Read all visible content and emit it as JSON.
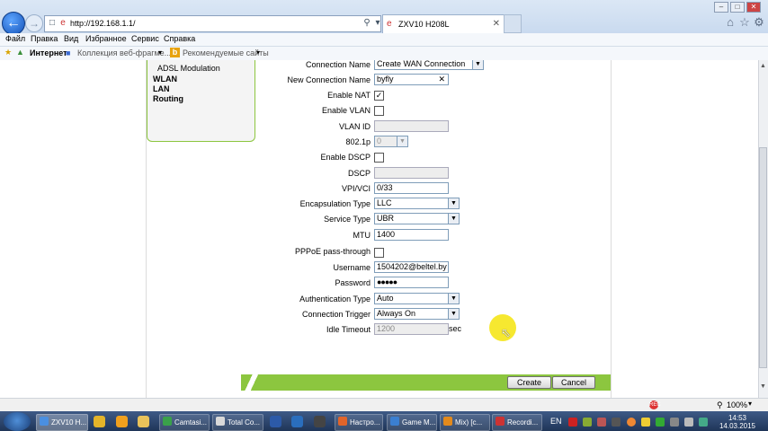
{
  "browser": {
    "url": "http://192.168.1.1/",
    "tab_title": "ZXV10 H208L",
    "menu": [
      "Файл",
      "Правка",
      "Вид",
      "Избранное",
      "Сервис",
      "Справка"
    ],
    "favbar": {
      "internet": "Интернет",
      "collection": "Коллекция веб-фрагме...",
      "recommended": "Рекомендуемые сайты"
    },
    "status_zoom": "100%"
  },
  "sidebar": {
    "items": [
      {
        "label": "ADSL Modulation"
      },
      {
        "label": "WLAN"
      },
      {
        "label": "LAN"
      },
      {
        "label": "Routing"
      }
    ]
  },
  "form": {
    "connection_name": {
      "label": "Connection Name",
      "value": "Create WAN Connection"
    },
    "new_connection_name": {
      "label": "New Connection Name",
      "value": "byfly"
    },
    "enable_nat": {
      "label": "Enable NAT",
      "checked": true
    },
    "enable_vlan": {
      "label": "Enable VLAN",
      "checked": false
    },
    "vlan_id": {
      "label": "VLAN ID",
      "value": ""
    },
    "dot1p": {
      "label": "802.1p",
      "value": "0"
    },
    "enable_dscp": {
      "label": "Enable DSCP",
      "checked": false
    },
    "dscp": {
      "label": "DSCP",
      "value": ""
    },
    "vpi_vci": {
      "label": "VPI/VCI",
      "value": "0/33"
    },
    "encapsulation": {
      "label": "Encapsulation Type",
      "value": "LLC"
    },
    "service_type": {
      "label": "Service Type",
      "value": "UBR"
    },
    "mtu": {
      "label": "MTU",
      "value": "1400"
    },
    "pppoe": {
      "label": "PPPoE pass-through",
      "checked": false
    },
    "username": {
      "label": "Username",
      "value": "1504202@beltel.by"
    },
    "password": {
      "label": "Password",
      "value": "●●●●●"
    },
    "auth_type": {
      "label": "Authentication Type",
      "value": "Auto"
    },
    "conn_trigger": {
      "label": "Connection Trigger",
      "value": "Always On"
    },
    "idle_timeout": {
      "label": "Idle Timeout",
      "value": "1200",
      "unit": "sec"
    }
  },
  "buttons": {
    "create": "Create",
    "cancel": "Cancel"
  },
  "taskbar": {
    "tasks": [
      "ZXV10 H...",
      "Camtasi...",
      "Total Co...",
      "Настро...",
      "Game M...",
      "Mix) [c...",
      "Recordi..."
    ],
    "lang": "EN",
    "time": "14:53",
    "date": "14.03.2015"
  },
  "colors": {
    "accent_green": "#8cc63f",
    "taskbar": "#1f3558"
  }
}
